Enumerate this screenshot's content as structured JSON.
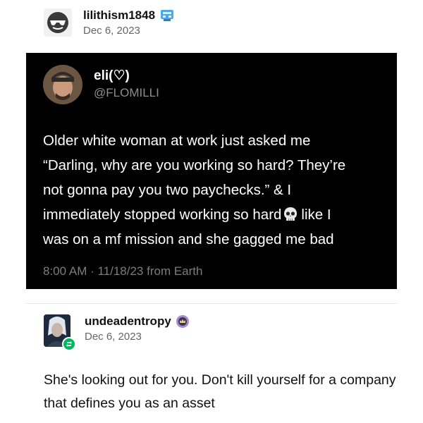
{
  "original_post": {
    "username": "lilithism1848",
    "date": "Dec 6, 2023"
  },
  "tweet": {
    "display_name": "eli(♡)",
    "handle": "@FLOMILLI",
    "lines": [
      "Older white woman at work just asked me",
      "“Darling, why are you working so hard? They’re",
      "not gonna pay you two paychecks.” & I",
      "immediately stopped working so hard",
      "like I",
      "was on a mf mission and she gagged me bad"
    ],
    "footer": "8:00 AM · 11/18/23 from Earth"
  },
  "reply": {
    "username": "undeadentropy",
    "date": "Dec 6, 2023",
    "text": "She's looking out for you. Don't kill yourself for a company that defines you as an asset"
  },
  "colors": {
    "tweet_background": "#000000",
    "reblog_green": "#00b85c",
    "badge_purple": "#a58ccf"
  }
}
